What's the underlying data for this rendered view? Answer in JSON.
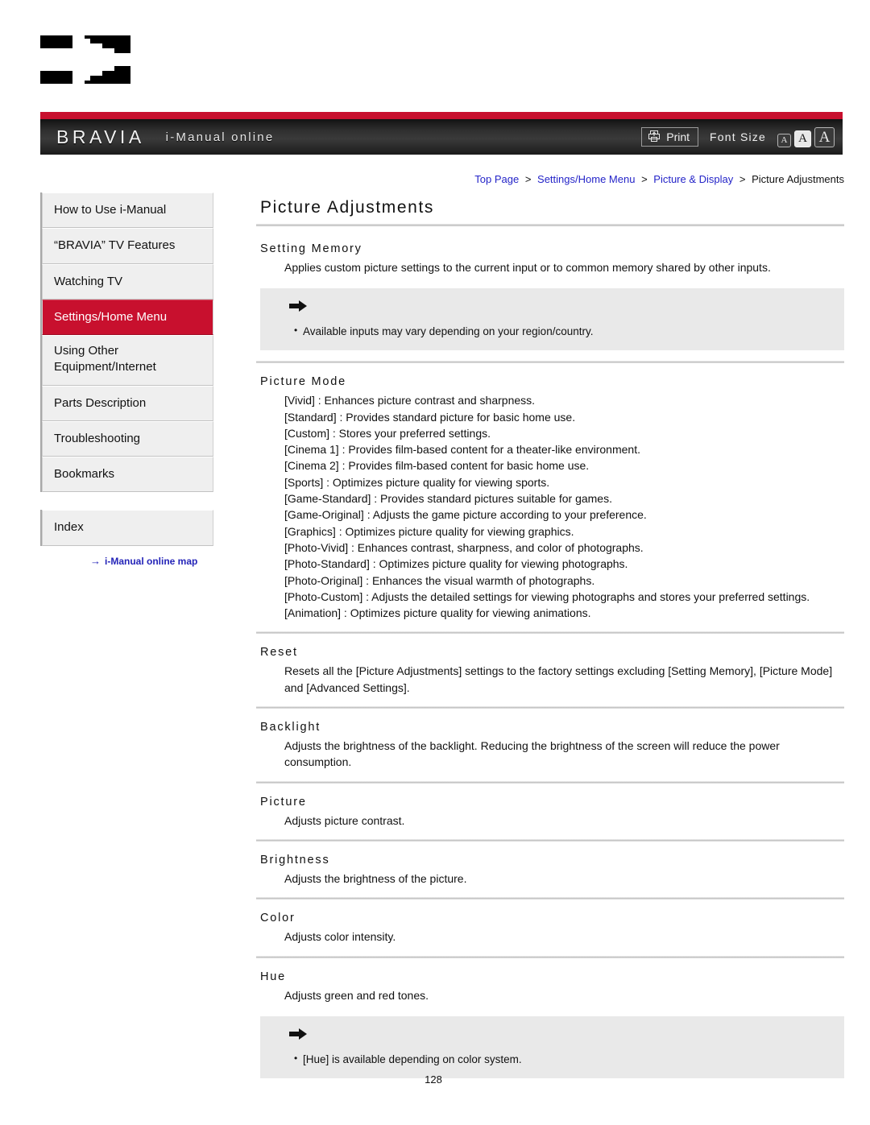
{
  "header": {
    "brand": "BRAVIA",
    "subtitle": "i-Manual online",
    "print_label": "Print",
    "font_size_label": "Font Size",
    "font_sizes": [
      {
        "label": "A",
        "size": "small",
        "selected": false
      },
      {
        "label": "A",
        "size": "medium",
        "selected": true
      },
      {
        "label": "A",
        "size": "large",
        "selected": false
      }
    ],
    "accent_color": "#C8102E"
  },
  "sidebar": {
    "items": [
      {
        "label": "How to Use i-Manual",
        "active": false
      },
      {
        "label": "“BRAVIA” TV Features",
        "active": false
      },
      {
        "label": "Watching TV",
        "active": false
      },
      {
        "label": "Settings/Home Menu",
        "active": true
      },
      {
        "label_line1": "Using Other",
        "label_line2": "Equipment/Internet",
        "active": false
      },
      {
        "label": "Parts Description",
        "active": false
      },
      {
        "label": "Troubleshooting",
        "active": false
      },
      {
        "label": "Bookmarks",
        "active": false
      }
    ],
    "index_item": {
      "label": "Index"
    },
    "map_link": {
      "label": "i-Manual online map",
      "arrow": "→",
      "color": "#2424b8"
    }
  },
  "breadcrumb": {
    "items": [
      {
        "label": "Top Page",
        "link": true
      },
      {
        "label": "Settings/Home Menu",
        "link": true
      },
      {
        "label": "Picture & Display",
        "link": true
      },
      {
        "label": "Picture Adjustments",
        "link": false
      }
    ],
    "separator": ">"
  },
  "main": {
    "title": "Picture Adjustments",
    "sections": [
      {
        "heading": "Setting Memory",
        "body": [
          "Applies custom picture settings to the current input or to common memory shared by other inputs."
        ],
        "note": {
          "icon": "right-arrow-icon",
          "items": [
            "Available inputs may vary depending on your region/country."
          ]
        }
      },
      {
        "heading": "Picture Mode",
        "body": [
          "[Vivid] : Enhances picture contrast and sharpness.",
          "[Standard] : Provides standard picture for basic home use.",
          "[Custom] : Stores your preferred settings.",
          "[Cinema 1] : Provides film-based content for a theater-like environment.",
          "[Cinema 2] : Provides film-based content for basic home use.",
          "[Sports] : Optimizes picture quality for viewing sports.",
          "[Game-Standard] : Provides standard pictures suitable for games.",
          "[Game-Original] : Adjusts the game picture according to your preference.",
          "[Graphics] : Optimizes picture quality for viewing graphics.",
          "[Photo-Vivid] : Enhances contrast, sharpness, and color of photographs.",
          "[Photo-Standard] : Optimizes picture quality for viewing photographs.",
          "[Photo-Original] : Enhances the visual warmth of photographs.",
          "[Photo-Custom] : Adjusts the detailed settings for viewing photographs and stores your preferred settings.",
          "[Animation] : Optimizes picture quality for viewing animations."
        ]
      },
      {
        "heading": "Reset",
        "body": [
          "Resets all the [Picture Adjustments] settings to the factory settings excluding [Setting Memory], [Picture Mode] and [Advanced Settings]."
        ]
      },
      {
        "heading": "Backlight",
        "body": [
          "Adjusts the brightness of the backlight. Reducing the brightness of the screen will reduce the power consumption."
        ]
      },
      {
        "heading": "Picture",
        "body": [
          "Adjusts picture contrast."
        ]
      },
      {
        "heading": "Brightness",
        "body": [
          "Adjusts the brightness of the picture."
        ]
      },
      {
        "heading": "Color",
        "body": [
          "Adjusts color intensity."
        ]
      },
      {
        "heading": "Hue",
        "body": [
          "Adjusts green and red tones."
        ],
        "note": {
          "icon": "right-arrow-icon",
          "items": [
            "[Hue] is available depending on color system."
          ]
        }
      }
    ]
  },
  "footer": {
    "page_number": "128"
  }
}
